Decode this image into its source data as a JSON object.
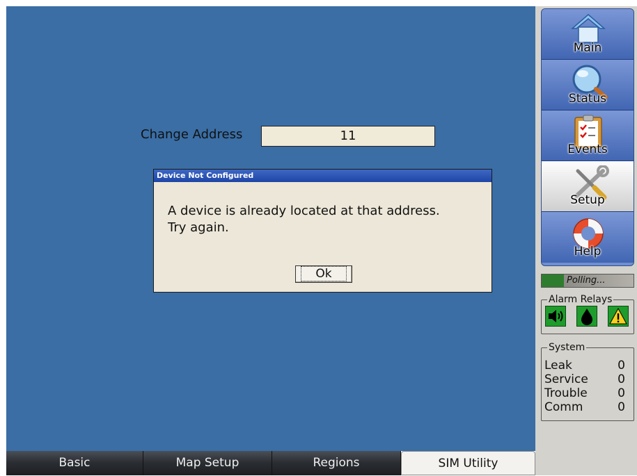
{
  "address": {
    "label": "Change Address",
    "value": "11"
  },
  "dialog": {
    "title": "Device Not Configured",
    "message_line1": "A device is already located at that address.",
    "message_line2": "Try again.",
    "ok_label": "Ok"
  },
  "tabs": [
    {
      "label": "Basic",
      "active": false
    },
    {
      "label": "Map Setup",
      "active": false
    },
    {
      "label": "Regions",
      "active": false
    },
    {
      "label": "SIM Utility",
      "active": true
    }
  ],
  "nav": [
    {
      "label": "Main",
      "icon": "home-icon"
    },
    {
      "label": "Status",
      "icon": "magnifier-icon"
    },
    {
      "label": "Events",
      "icon": "clipboard-icon"
    },
    {
      "label": "Setup",
      "icon": "tools-icon",
      "selected": true
    },
    {
      "label": "Help",
      "icon": "lifebuoy-icon"
    }
  ],
  "polling": {
    "text": "Polling..."
  },
  "alarm_relays": {
    "title": "Alarm Relays",
    "icons": [
      "speaker-icon",
      "drop-icon",
      "warning-icon"
    ]
  },
  "system": {
    "title": "System",
    "rows": [
      {
        "label": "Leak",
        "value": "0"
      },
      {
        "label": "Service",
        "value": "0"
      },
      {
        "label": "Trouble",
        "value": "0"
      },
      {
        "label": "Comm",
        "value": "0"
      }
    ]
  },
  "colors": {
    "background": "#3a6ea5",
    "dialog_title": "#1d45a6",
    "relay_green": "#1f9c2c",
    "warning_yellow": "#f7d11f"
  }
}
